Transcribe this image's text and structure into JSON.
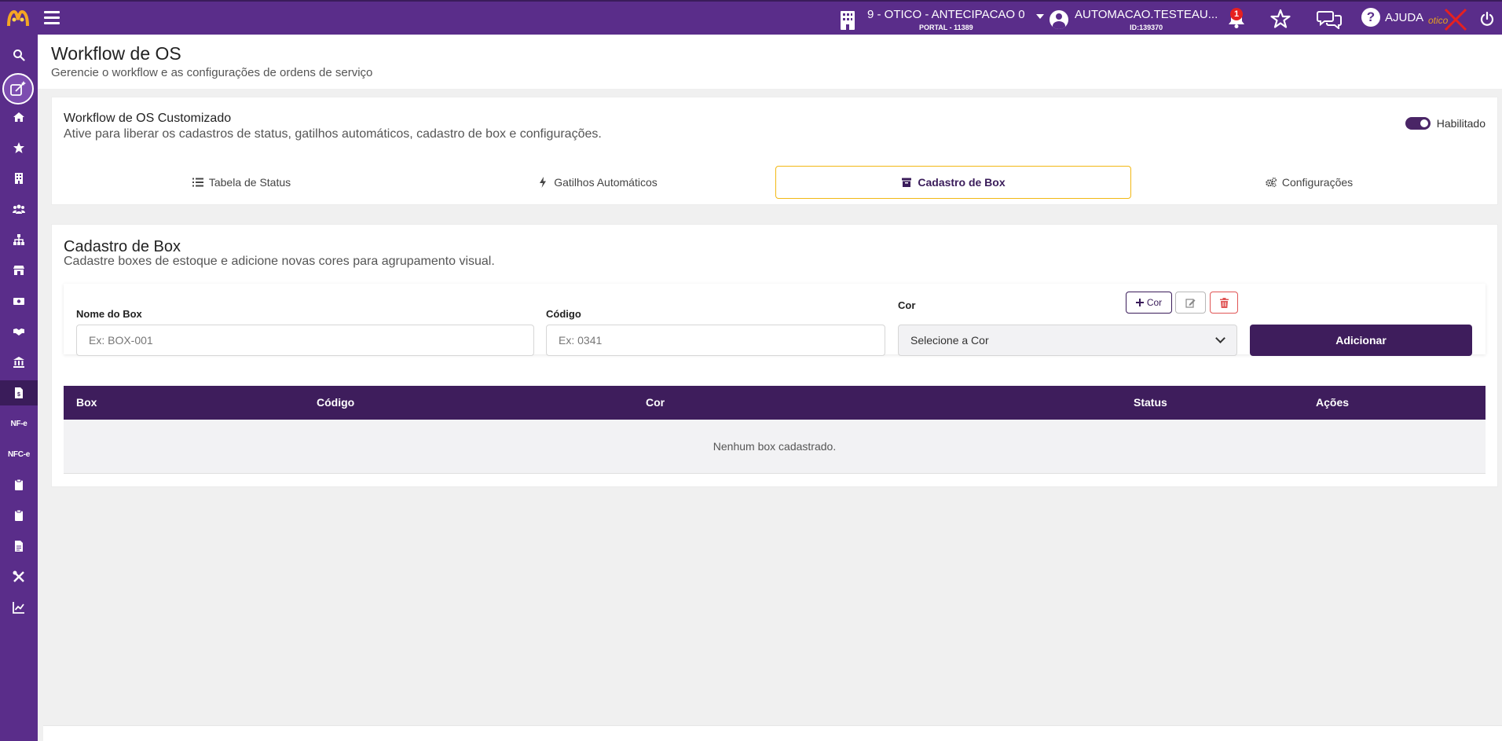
{
  "topbar": {
    "store_name": "9 - OTICO - ANTECIPACAO 0",
    "store_portal": "PORTAL - 11389",
    "user_name": "AUTOMACAO.TESTEAU...",
    "user_id": "ID:139370",
    "notification_count": "1",
    "help_label": "AJUDA"
  },
  "page": {
    "title": "Workflow de OS",
    "subtitle": "Gerencie o workflow e as configurações de ordens de serviço"
  },
  "workflow_card": {
    "title": "Workflow de OS Customizado",
    "description": "Ative para liberar os cadastros de status, gatilhos automáticos, cadastro de box e configurações.",
    "toggle_label": "Habilitado",
    "toggle_on": true,
    "tabs": [
      {
        "label": "Tabela de Status",
        "icon": "list-icon"
      },
      {
        "label": "Gatilhos Automáticos",
        "icon": "bolt-icon"
      },
      {
        "label": "Cadastro de Box",
        "icon": "box-icon",
        "active": true
      },
      {
        "label": "Configurações",
        "icon": "gears-icon"
      }
    ]
  },
  "box_card": {
    "title": "Cadastro de Box",
    "description": "Cadastre boxes de estoque e adicione novas cores para agrupamento visual.",
    "form": {
      "name_label": "Nome do Box",
      "name_placeholder": "Ex: BOX-001",
      "code_label": "Código",
      "code_placeholder": "Ex: 0341",
      "color_label": "Cor",
      "color_add_label": "Cor",
      "color_select_value": "Selecione a Cor",
      "add_button": "Adicionar"
    },
    "table": {
      "headers": [
        "Box",
        "Código",
        "Cor",
        "Status",
        "Ações"
      ],
      "empty_message": "Nenhum box cadastrado."
    }
  },
  "colors": {
    "brand_purple": "#5a2d8a",
    "dark_purple": "#3e1d5c",
    "active_tab_border": "#f2b814",
    "delete_red": "#e05555",
    "badge_red": "#e62020"
  }
}
